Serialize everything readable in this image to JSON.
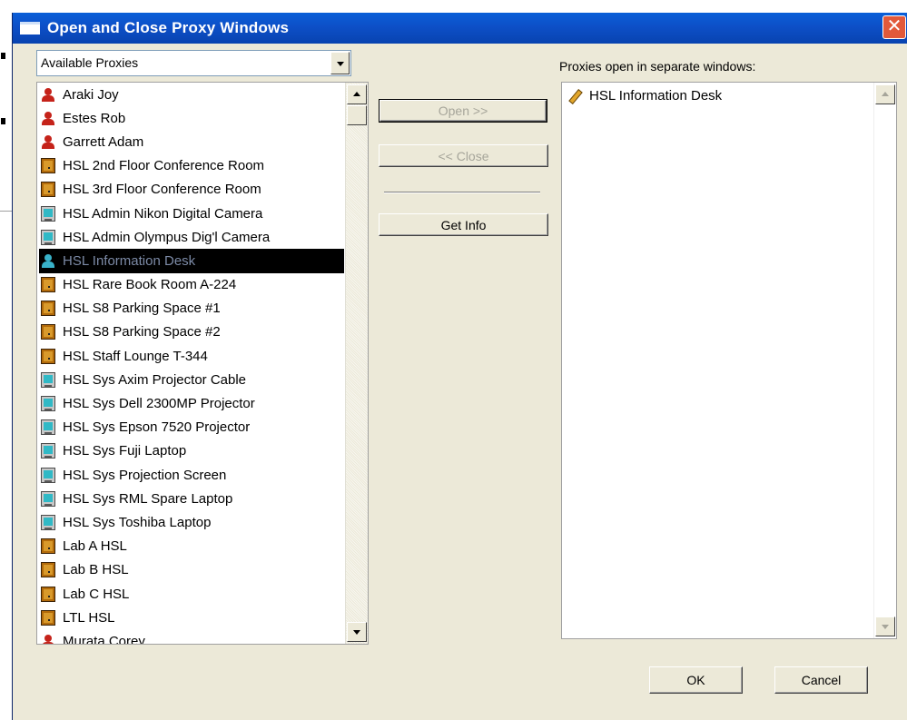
{
  "window": {
    "title": "Open and Close Proxy Windows",
    "close_glyph": "✕"
  },
  "proxy_filter": {
    "selected": "Available Proxies"
  },
  "available_list": {
    "items": [
      {
        "label": "Araki Joy",
        "icon": "person-icon",
        "selected": false
      },
      {
        "label": "Estes Rob",
        "icon": "person-icon",
        "selected": false
      },
      {
        "label": "Garrett Adam",
        "icon": "person-icon",
        "selected": false
      },
      {
        "label": "HSL 2nd Floor Conference Room",
        "icon": "door-icon",
        "selected": false
      },
      {
        "label": "HSL 3rd Floor Conference Room",
        "icon": "door-icon",
        "selected": false
      },
      {
        "label": "HSL Admin Nikon Digital Camera",
        "icon": "equipment-icon",
        "selected": false
      },
      {
        "label": "HSL Admin Olympus Dig'l Camera",
        "icon": "equipment-icon",
        "selected": false
      },
      {
        "label": "HSL Information Desk",
        "icon": "person-icon",
        "selected": true
      },
      {
        "label": "HSL Rare Book Room A-224",
        "icon": "door-icon",
        "selected": false
      },
      {
        "label": "HSL S8 Parking Space #1",
        "icon": "door-icon",
        "selected": false
      },
      {
        "label": "HSL S8 Parking Space #2",
        "icon": "door-icon",
        "selected": false
      },
      {
        "label": "HSL Staff Lounge T-344",
        "icon": "door-icon",
        "selected": false
      },
      {
        "label": "HSL Sys Axim Projector Cable",
        "icon": "equipment-icon",
        "selected": false
      },
      {
        "label": "HSL Sys Dell 2300MP Projector",
        "icon": "equipment-icon",
        "selected": false
      },
      {
        "label": "HSL Sys Epson 7520 Projector",
        "icon": "equipment-icon",
        "selected": false
      },
      {
        "label": "HSL Sys Fuji Laptop",
        "icon": "equipment-icon",
        "selected": false
      },
      {
        "label": "HSL Sys Projection Screen",
        "icon": "equipment-icon",
        "selected": false
      },
      {
        "label": "HSL Sys RML Spare Laptop",
        "icon": "equipment-icon",
        "selected": false
      },
      {
        "label": "HSL Sys Toshiba Laptop",
        "icon": "equipment-icon",
        "selected": false
      },
      {
        "label": "Lab A HSL",
        "icon": "door-icon",
        "selected": false
      },
      {
        "label": "Lab B HSL",
        "icon": "door-icon",
        "selected": false
      },
      {
        "label": "Lab C HSL",
        "icon": "door-icon",
        "selected": false
      },
      {
        "label": "LTL HSL",
        "icon": "door-icon",
        "selected": false
      },
      {
        "label": "Murata Corey",
        "icon": "person-icon",
        "selected": false
      }
    ]
  },
  "actions": {
    "open_label": "Open >>",
    "close_label": "<< Close",
    "get_info_label": "Get Info"
  },
  "open_windows": {
    "heading": "Proxies open in separate windows:",
    "items": [
      {
        "label": "HSL Information Desk",
        "icon": "pencil-icon"
      }
    ]
  },
  "footer": {
    "ok_label": "OK",
    "cancel_label": "Cancel"
  },
  "colors": {
    "titlebar": "#0a5fd8",
    "dialog_face": "#ece9d8",
    "selection_bg": "#000000",
    "person_icon": "#c5231a",
    "selected_person_icon": "#39b2c9",
    "door_icon": "#b26a0a",
    "equipment_icon": "#30b9c6"
  }
}
